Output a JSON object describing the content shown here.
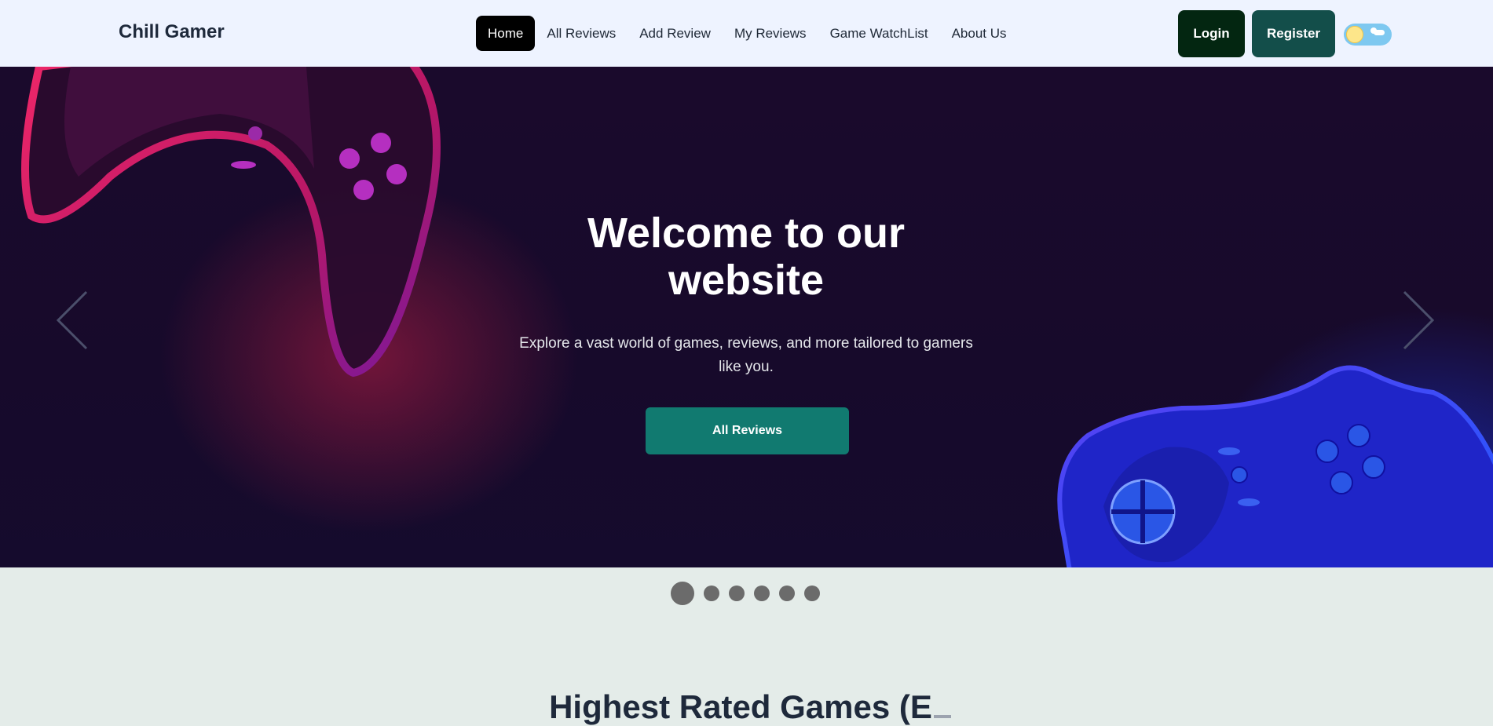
{
  "navbar": {
    "brand": "Chill Gamer",
    "links": [
      {
        "label": "Home",
        "active": true
      },
      {
        "label": "All Reviews"
      },
      {
        "label": "Add Review"
      },
      {
        "label": "My Reviews"
      },
      {
        "label": "Game WatchList"
      },
      {
        "label": "About Us"
      }
    ],
    "login_label": "Login",
    "register_label": "Register",
    "theme_toggle": {
      "state": "light",
      "icons": [
        "sun-icon",
        "cloud-icon"
      ]
    }
  },
  "hero": {
    "title": "Welcome to our website",
    "subtitle": "Explore a vast world of games, reviews, and more tailored to gamers like you.",
    "cta_label": "All Reviews",
    "slides_count": 6,
    "active_slide": 1,
    "prev_icon": "chevron-left-icon",
    "next_icon": "chevron-right-icon"
  },
  "section": {
    "title": "Highest Rated Games (E"
  },
  "colors": {
    "navbar_bg": "#eef3ff",
    "login_bg": "#032611",
    "register_bg": "#134e4a",
    "cta_bg": "#117a70",
    "page_bg": "#e4ece9"
  }
}
